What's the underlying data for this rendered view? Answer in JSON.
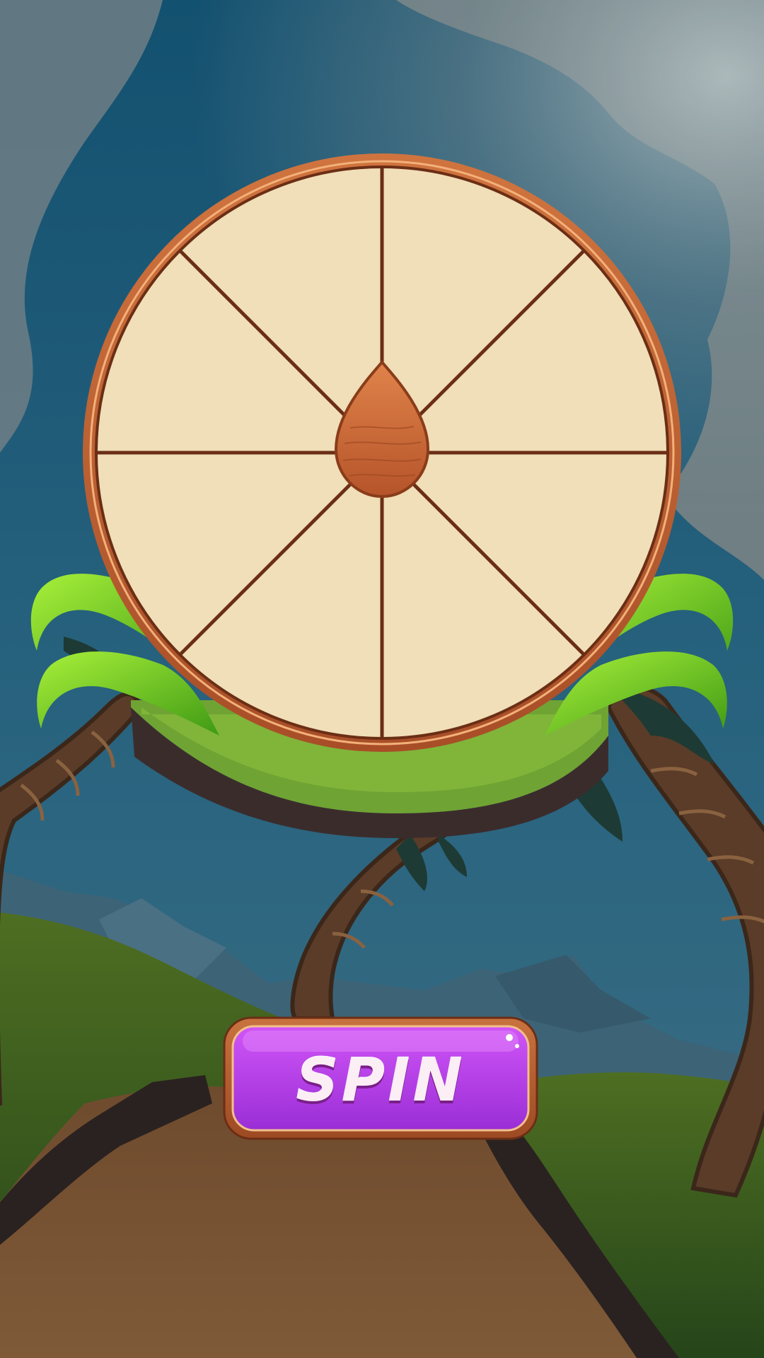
{
  "game": {
    "spin_button_label": "SPIN"
  },
  "wheel": {
    "segment_count": 8,
    "segment_labels": [
      "",
      "",
      "",
      "",
      "",
      "",
      "",
      ""
    ],
    "pointer_icon": "droplet-pointer-icon"
  },
  "colors": {
    "sky": "#1d5676",
    "wheel_face": "#f0dfb8",
    "wheel_rim": "#c2643a",
    "wheel_lines": "#6b2e15",
    "leaves": "#7cd427",
    "spin_button": "#b93ff0",
    "spin_button_frame": "#b45b2c",
    "ground": "#7a5535"
  }
}
